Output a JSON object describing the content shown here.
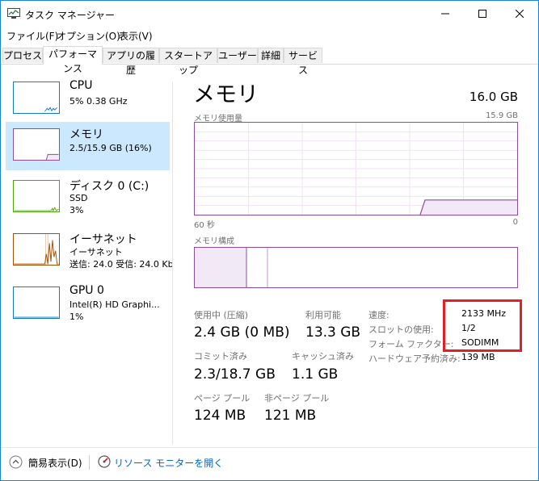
{
  "window": {
    "title": "タスク マネージャー"
  },
  "menu": [
    "ファイル(F)",
    "オプション(O)",
    "表示(V)"
  ],
  "tabs": [
    "プロセス",
    "パフォーマンス",
    "アプリの履歴",
    "スタートアップ",
    "ユーザー",
    "詳細",
    "サービス"
  ],
  "sidebar": {
    "cpu": {
      "title": "CPU",
      "line1": "5%  0.38 GHz"
    },
    "memory": {
      "title": "メモリ",
      "line1": "2.5/15.9 GB (16%)"
    },
    "disk": {
      "title": "ディスク 0 (C:)",
      "line1": "SSD",
      "line2": "3%"
    },
    "ethernet": {
      "title": "イーサネット",
      "line1": "イーサネット",
      "line2": "送信: 24.0  受信: 24.0 Kb"
    },
    "gpu": {
      "title": "GPU 0",
      "line1": "Intel(R) HD Graphi...",
      "line2": "1%"
    }
  },
  "main": {
    "title": "メモリ",
    "total": "16.0 GB",
    "usage_label": "メモリ使用量",
    "usage_max": "15.9 GB",
    "axis_left": "60 秒",
    "axis_right": "0",
    "composition_label": "メモリ構成",
    "usage_fraction": 0.16
  },
  "stats": {
    "in_use_label": "使用中 (圧縮)",
    "in_use_value": "2.4 GB (0 MB)",
    "available_label": "利用可能",
    "available_value": "13.3 GB",
    "committed_label": "コミット済み",
    "committed_value": "2.3/18.7 GB",
    "cached_label": "キャッシュ済み",
    "cached_value": "1.1 GB",
    "paged_label": "ページ プール",
    "paged_value": "124 MB",
    "nonpaged_label": "非ページ プール",
    "nonpaged_value": "121 MB"
  },
  "props": {
    "speed_label": "速度:",
    "speed_value": "2133 MHz",
    "slots_label": "スロットの使用:",
    "slots_value": "1/2",
    "form_label": "フォーム ファクター:",
    "form_value": "SODIMM",
    "reserved_label": "ハードウェア予約済み:",
    "reserved_value": "139 MB"
  },
  "footer": {
    "simple_label": "簡易表示(D)",
    "monitor_label": "リソース モニターを開く"
  },
  "colors": {
    "memory": "#8b4d9c",
    "cpu": "#117dbb",
    "disk": "#4da60c",
    "ethernet": "#a74f01",
    "gpu": "#117dbb",
    "selection": "#cce8ff",
    "highlight": "#e31e24"
  }
}
